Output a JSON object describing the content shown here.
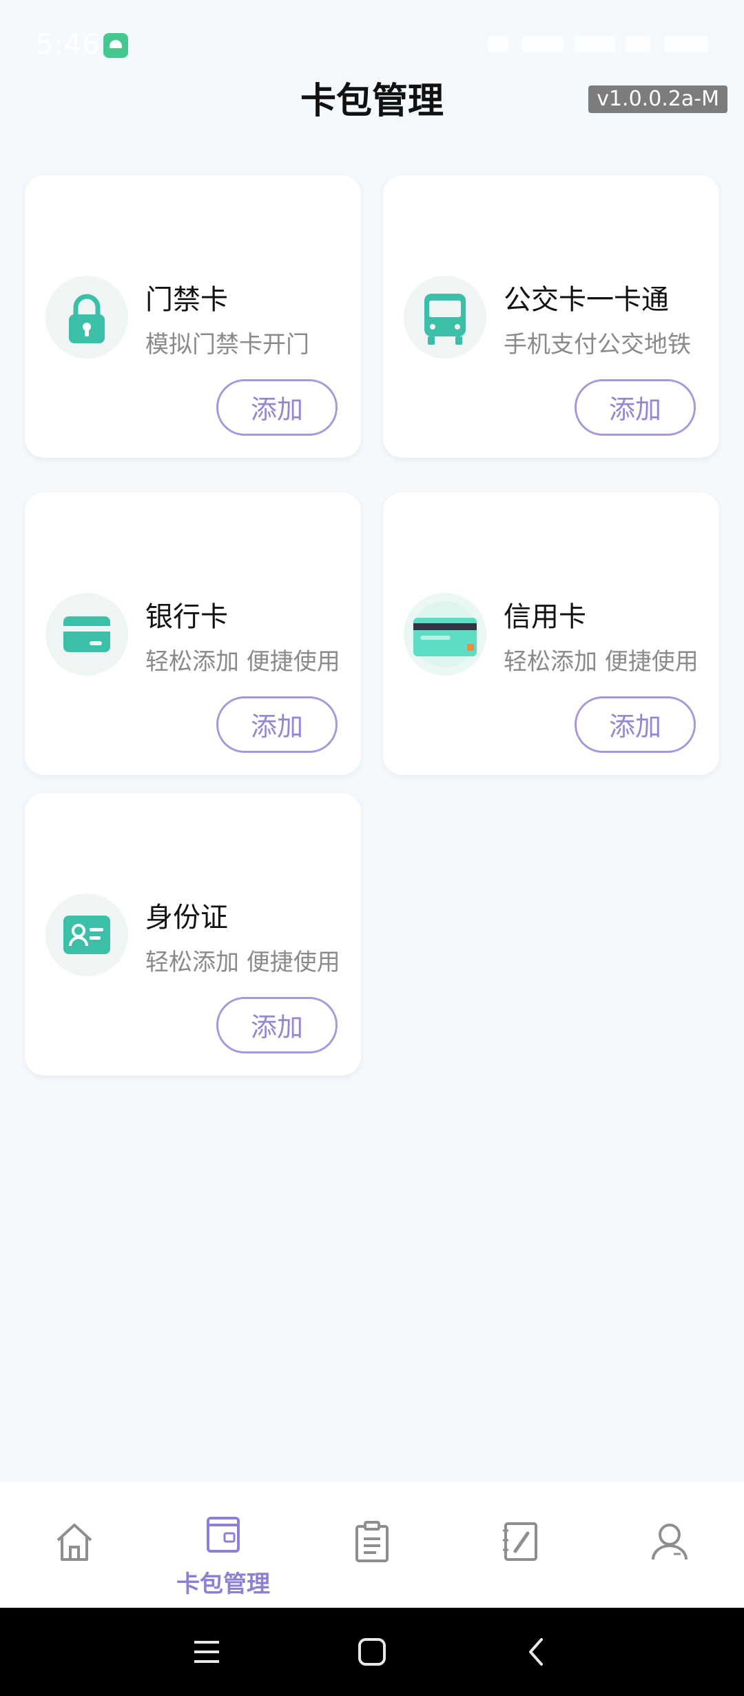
{
  "status_bar": {
    "time": "5:46"
  },
  "header": {
    "title": "卡包管理",
    "version": "v1.0.0.2a-M"
  },
  "cards": [
    {
      "title": "门禁卡",
      "subtitle": "模拟门禁卡开门",
      "button": "添加",
      "icon": "lock-icon"
    },
    {
      "title": "公交卡一卡通",
      "subtitle": "手机支付公交地铁",
      "button": "添加",
      "icon": "bus-icon"
    },
    {
      "title": "银行卡",
      "subtitle": "轻松添加 便捷使用",
      "button": "添加",
      "icon": "bank-card-icon"
    },
    {
      "title": "信用卡",
      "subtitle": "轻松添加 便捷使用",
      "button": "添加",
      "icon": "credit-card-icon"
    },
    {
      "title": "身份证",
      "subtitle": "轻松添加 便捷使用",
      "button": "添加",
      "icon": "id-card-icon"
    }
  ],
  "bottom_nav": {
    "items": [
      {
        "icon": "home-icon",
        "label": ""
      },
      {
        "icon": "wallet-icon",
        "label": "卡包管理",
        "active": true
      },
      {
        "icon": "clipboard-icon",
        "label": ""
      },
      {
        "icon": "edit-icon",
        "label": ""
      },
      {
        "icon": "user-icon",
        "label": ""
      }
    ]
  },
  "colors": {
    "background": "#F4F9FE",
    "accent": "#8F7FD3",
    "icon_green": "#3BBFA7",
    "subtitle": "#8A8A8A"
  }
}
